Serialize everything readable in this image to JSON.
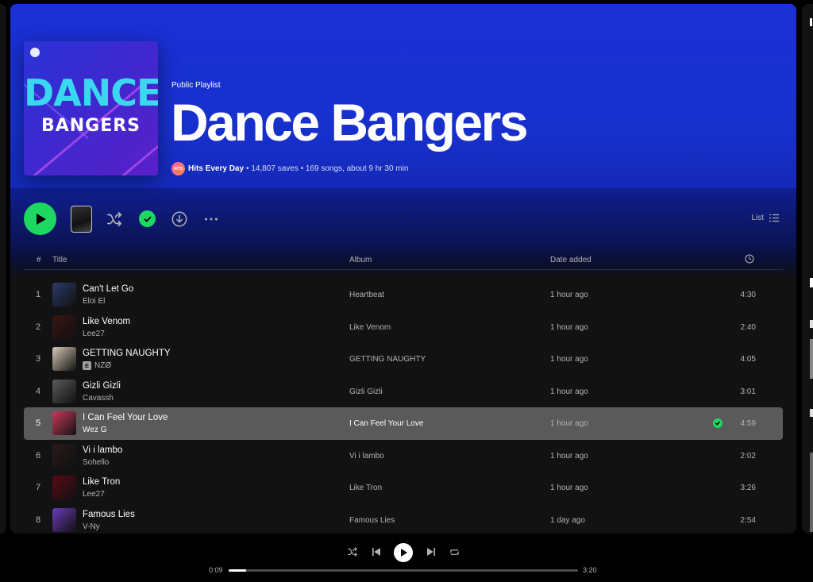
{
  "playlist": {
    "type": "Public Playlist",
    "title": "Dance Bangers",
    "cover": {
      "line1": "DANCE",
      "line2": "BANGERS"
    },
    "owner": "Hits Every Day",
    "owner_badge": "HITS",
    "stats": "• 14,807 saves • 169 songs, about 9 hr 30 min"
  },
  "controls": {
    "view_label": "List"
  },
  "table": {
    "col_num": "#",
    "col_title": "Title",
    "col_album": "Album",
    "col_added": "Date added"
  },
  "tracks": [
    {
      "num": "1",
      "title": "Can't Let Go",
      "artist": "Eloi El",
      "explicit": false,
      "album": "Heartbeat",
      "added": "1 hour ago",
      "duration": "4:30",
      "art_color": "#2a3a6a"
    },
    {
      "num": "2",
      "title": "Like Venom",
      "artist": "Lee27",
      "explicit": false,
      "album": "Like Venom",
      "added": "1 hour ago",
      "duration": "2:40",
      "art_color": "#3a1414"
    },
    {
      "num": "3",
      "title": "GETTING NAUGHTY",
      "artist": "NZØ",
      "explicit": true,
      "explicit_label": "E",
      "album": "GETTING NAUGHTY",
      "added": "1 hour ago",
      "duration": "4:05",
      "art_color": "#d8c8b8"
    },
    {
      "num": "4",
      "title": "Gizli Gizli",
      "artist": "Cavassh",
      "explicit": false,
      "album": "Gizli Gizli",
      "added": "1 hour ago",
      "duration": "3:01",
      "art_color": "#5a5a5a"
    },
    {
      "num": "5",
      "title": "I Can Feel Your Love",
      "artist": "Wez G",
      "explicit": false,
      "album": "I Can Feel Your Love",
      "added": "1 hour ago",
      "duration": "4:59",
      "art_color": "#c83a5a",
      "liked": true
    },
    {
      "num": "6",
      "title": "Vi i lambo",
      "artist": "Sohello",
      "explicit": false,
      "album": "Vi i lambo",
      "added": "1 hour ago",
      "duration": "2:02",
      "art_color": "#2a1a1a"
    },
    {
      "num": "7",
      "title": "Like Tron",
      "artist": "Lee27",
      "explicit": false,
      "album": "Like Tron",
      "added": "1 hour ago",
      "duration": "3:26",
      "art_color": "#5a0a14"
    },
    {
      "num": "8",
      "title": "Famous Lies",
      "artist": "V-Ny",
      "explicit": false,
      "album": "Famous Lies",
      "added": "1 day ago",
      "duration": "2:54",
      "art_color": "#6a3ab8"
    }
  ],
  "active_index": 4,
  "player": {
    "elapsed": "0:09",
    "total": "3:20",
    "progress": 0.05
  },
  "colors": {
    "accent": "#1ed760",
    "hero": "#1b2fd6",
    "background": "#121212"
  }
}
